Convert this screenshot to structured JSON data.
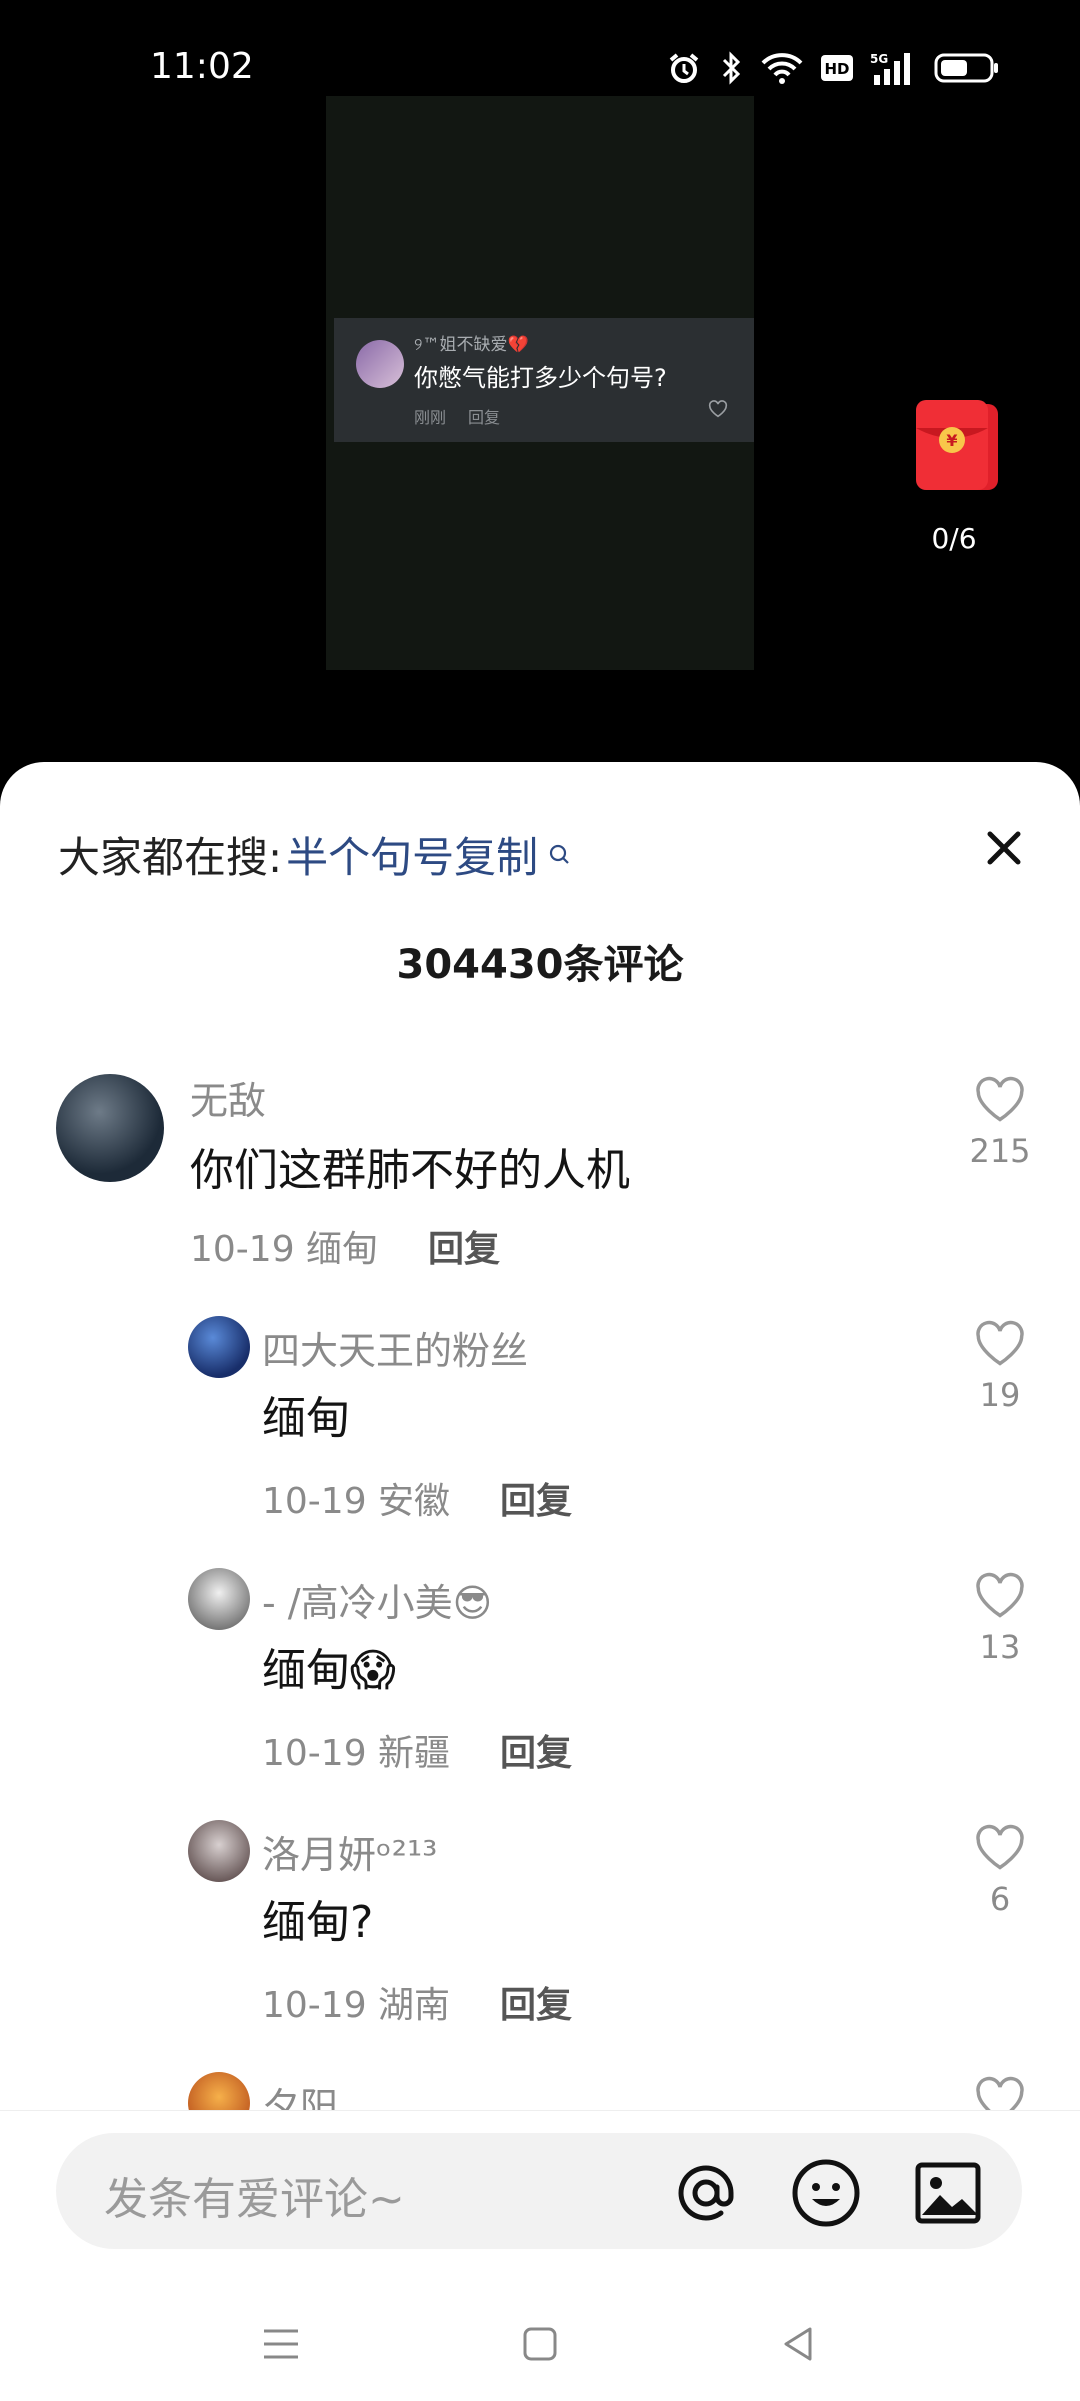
{
  "status": {
    "time": "11:02"
  },
  "video": {
    "card_user": "୨™姐不缺爱💔",
    "card_text": "你憋气能打多少个句号?",
    "card_time": "刚刚",
    "card_reply": "回复",
    "redpacket_count": "0/6"
  },
  "sheet": {
    "search_prefix": "大家都在搜:",
    "search_term": "半个句号复制",
    "comment_count": "304430条评论"
  },
  "comments": [
    {
      "user": "无敌",
      "text": "你们这群肺不好的人机",
      "meta": "10-19 缅甸",
      "reply": "回复",
      "likes": "215"
    },
    {
      "user": "四大天王的粉丝",
      "text": "缅甸",
      "meta": "10-19 安徽",
      "reply": "回复",
      "likes": "19"
    },
    {
      "user": "- /高冷小美😎",
      "text": "缅甸😱",
      "meta": "10-19 新疆",
      "reply": "回复",
      "likes": "13"
    },
    {
      "user": "洛月妍ᵒ²¹³",
      "text": "缅甸?",
      "meta": "10-19 湖南",
      "reply": "回复",
      "likes": "6"
    },
    {
      "user": "夕阳"
    }
  ],
  "input": {
    "placeholder": "发条有爱评论~"
  },
  "icons": [
    "alarm-icon",
    "bluetooth-icon",
    "wifi-icon",
    "hd-icon",
    "signal-5g-icon",
    "battery-icon",
    "heart-icon",
    "search-icon",
    "close-icon",
    "at-icon",
    "emoji-icon",
    "image-icon",
    "menu-icon",
    "home-icon",
    "back-icon"
  ]
}
